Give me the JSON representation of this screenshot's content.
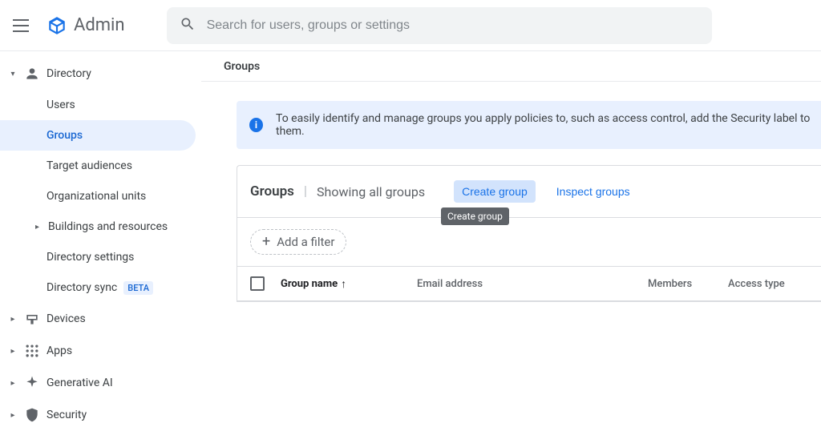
{
  "header": {
    "app_name": "Admin"
  },
  "search": {
    "placeholder": "Search for users, groups or settings"
  },
  "sidebar": {
    "directory": {
      "label": "Directory",
      "items": {
        "users": "Users",
        "groups": "Groups",
        "target_audiences": "Target audiences",
        "organizational_units": "Organizational units",
        "buildings": "Buildings and resources",
        "directory_settings": "Directory settings",
        "directory_sync": "Directory sync",
        "beta_badge": "BETA"
      }
    },
    "devices": "Devices",
    "apps": "Apps",
    "generative_ai": "Generative AI",
    "security": "Security"
  },
  "breadcrumb": "Groups",
  "banner": "To easily identify and manage groups you apply policies to, such as access control, add the Security label to them.",
  "panel": {
    "title": "Groups",
    "subtitle": "Showing all groups",
    "create_group": "Create group",
    "inspect_groups": "Inspect groups",
    "tooltip": "Create group",
    "add_filter": "Add a filter"
  },
  "columns": {
    "group_name": "Group name",
    "email": "Email address",
    "members": "Members",
    "access_type": "Access type"
  }
}
